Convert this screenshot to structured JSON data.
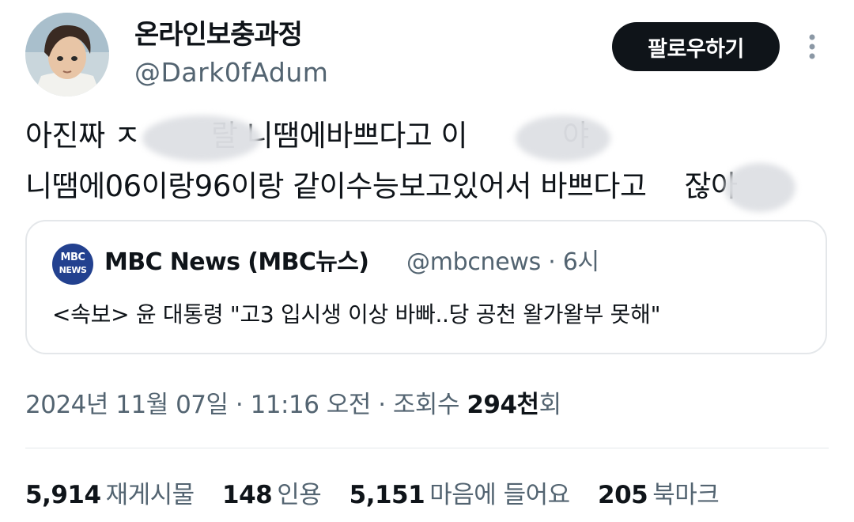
{
  "author": {
    "display_name": "온라인보충과정",
    "handle": "@Dark0fAdum",
    "avatar": "anime-character-avatar"
  },
  "follow_button": {
    "label": "팔로우하기"
  },
  "more_icon": "more-vertical-icon",
  "tweet": {
    "line1": {
      "a": "아진짜",
      "b": "ㅈ",
      "c": "랄 니땜에바쁘다고 이",
      "d": "야"
    },
    "line2": {
      "a": "니땜에06이랑96이랑 같이수능보고있어서 바쁘다고",
      "b": "잖아"
    }
  },
  "quote": {
    "logo_line1": "MBC",
    "logo_line2": "NEWS",
    "name": "MBC News (MBC뉴스)",
    "handle": "@mbcnews",
    "time": "· 6시",
    "text": "<속보> 윤 대통령 \"고3 입시생 이상 바빠..당 공천 왈가왈부 못해\""
  },
  "timestamp": {
    "prefix": "2024년 11월 07일 · 11:16 오전 · 조회수",
    "views": "294천",
    "suffix": "회"
  },
  "stats": {
    "retweets": {
      "count": "5,914",
      "label": "재게시물"
    },
    "quotes": {
      "count": "148",
      "label": "인용"
    },
    "likes": {
      "count": "5,151",
      "label": "마음에 들어요"
    },
    "bookmarks": {
      "count": "205",
      "label": "북마크"
    }
  },
  "colors": {
    "text": "#0f1419",
    "secondary": "#536471",
    "button_bg": "#0f1419",
    "border": "#e4e7ea",
    "mbc_blue": "#23418f"
  }
}
